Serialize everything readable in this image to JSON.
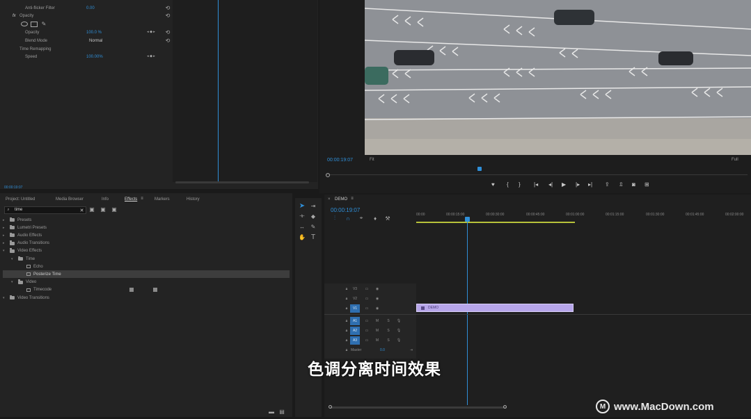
{
  "effect_controls": {
    "anti_flicker_label": "Anti-flicker Filter",
    "anti_flicker_value": "0.00",
    "opacity_header": "Opacity",
    "opacity_label": "Opacity",
    "opacity_value": "100.0 %",
    "blend_mode_label": "Blend Mode",
    "blend_mode_value": "Normal",
    "time_remapping_label": "Time Remapping",
    "speed_label": "Speed",
    "speed_value": "100.00%",
    "timecode": "00:00:19:07"
  },
  "program_monitor": {
    "timecode": "00:00:19:07",
    "fit_label": "Fit",
    "quality_label": "Full"
  },
  "project_panel": {
    "tabs": [
      "Project: Untitled",
      "Media Browser",
      "Info",
      "Effects",
      "Markers",
      "History"
    ],
    "active_tab": "Effects",
    "search_value": "time",
    "tree": [
      {
        "label": "Presets",
        "level": 0,
        "type": "folder"
      },
      {
        "label": "Lumetri Presets",
        "level": 0,
        "type": "folder"
      },
      {
        "label": "Audio Effects",
        "level": 0,
        "type": "folder"
      },
      {
        "label": "Audio Transitions",
        "level": 0,
        "type": "folder"
      },
      {
        "label": "Video Effects",
        "level": 0,
        "type": "folder"
      },
      {
        "label": "Time",
        "level": 1,
        "type": "folder"
      },
      {
        "label": "Echo",
        "level": 2,
        "type": "effect"
      },
      {
        "label": "Posterize Time",
        "level": 2,
        "type": "effect",
        "selected": true
      },
      {
        "label": "Video",
        "level": 1,
        "type": "folder"
      },
      {
        "label": "Timecode",
        "level": 2,
        "type": "effect"
      },
      {
        "label": "Video Transitions",
        "level": 0,
        "type": "folder"
      }
    ]
  },
  "timeline": {
    "sequence_name": "DEMO",
    "timecode": "00:00:19:07",
    "ruler": [
      "00:00",
      "00:00:15:00",
      "00:00:30:00",
      "00:00:45:00",
      "00:01:00:00",
      "00:01:15:00",
      "00:01:30:00",
      "00:01:45:00",
      "00:02:00:00"
    ],
    "video_tracks": [
      "V3",
      "V2",
      "V1"
    ],
    "audio_tracks": [
      "A1",
      "A2",
      "A3"
    ],
    "master_label": "Master",
    "master_value": "0.0",
    "clip_label": "DEMO",
    "mute_label": "M",
    "solo_label": "S"
  },
  "caption": "色调分离时间效果",
  "watermark": "www.MacDown.com",
  "colors": {
    "accent": "#2f8fd8",
    "clip": "#b7a6ea",
    "panel": "#232323",
    "background": "#1a1a1a"
  }
}
